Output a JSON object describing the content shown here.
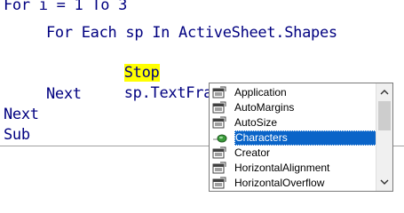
{
  "code": {
    "line1": "For i = 1 To 3",
    "line2": "For Each sp In ActiveSheet.Shapes",
    "line3_keyword": "Stop",
    "line4": "sp.TextFrame.",
    "line5": "Next",
    "line6": "Next",
    "line7": "Sub"
  },
  "autocomplete": {
    "items": [
      {
        "label": "Application",
        "icon": "property-icon"
      },
      {
        "label": "AutoMargins",
        "icon": "property-icon"
      },
      {
        "label": "AutoSize",
        "icon": "property-icon"
      },
      {
        "label": "Characters",
        "icon": "method-icon",
        "selected": true
      },
      {
        "label": "Creator",
        "icon": "property-icon"
      },
      {
        "label": "HorizontalAlignment",
        "icon": "property-icon"
      },
      {
        "label": "HorizontalOverflow",
        "icon": "property-icon"
      }
    ],
    "scroll_up_glyph": "^",
    "scroll_down_glyph": "v"
  },
  "colors": {
    "keyword": "#000080",
    "highlight": "#ffff00",
    "selection": "#0a64c8"
  }
}
